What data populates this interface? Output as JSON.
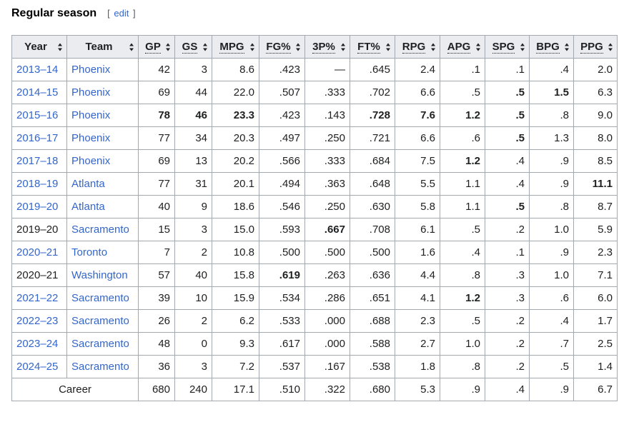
{
  "section": {
    "title": "Regular season",
    "edit_open": "[",
    "edit_label": "edit",
    "edit_close": "]"
  },
  "columns": [
    {
      "key": "year",
      "label": "Year",
      "abbr": false
    },
    {
      "key": "team",
      "label": "Team",
      "abbr": false
    },
    {
      "key": "gp",
      "label": "GP",
      "abbr": true
    },
    {
      "key": "gs",
      "label": "GS",
      "abbr": true
    },
    {
      "key": "mpg",
      "label": "MPG",
      "abbr": true
    },
    {
      "key": "fg",
      "label": "FG%",
      "abbr": true
    },
    {
      "key": "3p",
      "label": "3P%",
      "abbr": true
    },
    {
      "key": "ft",
      "label": "FT%",
      "abbr": true
    },
    {
      "key": "rpg",
      "label": "RPG",
      "abbr": true
    },
    {
      "key": "apg",
      "label": "APG",
      "abbr": true
    },
    {
      "key": "spg",
      "label": "SPG",
      "abbr": true
    },
    {
      "key": "bpg",
      "label": "BPG",
      "abbr": true
    },
    {
      "key": "ppg",
      "label": "PPG",
      "abbr": true
    }
  ],
  "rows": [
    {
      "year": "2013–14",
      "year_link": true,
      "team": "Phoenix",
      "team_link": true,
      "gp": "42",
      "gs": "3",
      "mpg": "8.6",
      "fg": ".423",
      "3p": "—",
      "ft": ".645",
      "rpg": "2.4",
      "apg": ".1",
      "spg": ".1",
      "bpg": ".4",
      "ppg": "2.0",
      "bold": []
    },
    {
      "year": "2014–15",
      "year_link": true,
      "team": "Phoenix",
      "team_link": true,
      "gp": "69",
      "gs": "44",
      "mpg": "22.0",
      "fg": ".507",
      "3p": ".333",
      "ft": ".702",
      "rpg": "6.6",
      "apg": ".5",
      "spg": ".5",
      "bpg": "1.5",
      "ppg": "6.3",
      "bold": [
        "spg",
        "bpg"
      ]
    },
    {
      "year": "2015–16",
      "year_link": true,
      "team": "Phoenix",
      "team_link": true,
      "gp": "78",
      "gs": "46",
      "mpg": "23.3",
      "fg": ".423",
      "3p": ".143",
      "ft": ".728",
      "rpg": "7.6",
      "apg": "1.2",
      "spg": ".5",
      "bpg": ".8",
      "ppg": "9.0",
      "bold": [
        "gp",
        "gs",
        "mpg",
        "ft",
        "rpg",
        "apg",
        "spg"
      ]
    },
    {
      "year": "2016–17",
      "year_link": true,
      "team": "Phoenix",
      "team_link": true,
      "gp": "77",
      "gs": "34",
      "mpg": "20.3",
      "fg": ".497",
      "3p": ".250",
      "ft": ".721",
      "rpg": "6.6",
      "apg": ".6",
      "spg": ".5",
      "bpg": "1.3",
      "ppg": "8.0",
      "bold": [
        "spg"
      ]
    },
    {
      "year": "2017–18",
      "year_link": true,
      "team": "Phoenix",
      "team_link": true,
      "gp": "69",
      "gs": "13",
      "mpg": "20.2",
      "fg": ".566",
      "3p": ".333",
      "ft": ".684",
      "rpg": "7.5",
      "apg": "1.2",
      "spg": ".4",
      "bpg": ".9",
      "ppg": "8.5",
      "bold": [
        "apg"
      ]
    },
    {
      "year": "2018–19",
      "year_link": true,
      "team": "Atlanta",
      "team_link": true,
      "gp": "77",
      "gs": "31",
      "mpg": "20.1",
      "fg": ".494",
      "3p": ".363",
      "ft": ".648",
      "rpg": "5.5",
      "apg": "1.1",
      "spg": ".4",
      "bpg": ".9",
      "ppg": "11.1",
      "bold": [
        "ppg"
      ]
    },
    {
      "year": "2019–20",
      "year_link": true,
      "team": "Atlanta",
      "team_link": true,
      "gp": "40",
      "gs": "9",
      "mpg": "18.6",
      "fg": ".546",
      "3p": ".250",
      "ft": ".630",
      "rpg": "5.8",
      "apg": "1.1",
      "spg": ".5",
      "bpg": ".8",
      "ppg": "8.7",
      "bold": [
        "spg"
      ]
    },
    {
      "year": "2019–20",
      "year_link": false,
      "team": "Sacramento",
      "team_link": true,
      "gp": "15",
      "gs": "3",
      "mpg": "15.0",
      "fg": ".593",
      "3p": ".667",
      "ft": ".708",
      "rpg": "6.1",
      "apg": ".5",
      "spg": ".2",
      "bpg": "1.0",
      "ppg": "5.9",
      "bold": [
        "3p"
      ]
    },
    {
      "year": "2020–21",
      "year_link": true,
      "team": "Toronto",
      "team_link": true,
      "gp": "7",
      "gs": "2",
      "mpg": "10.8",
      "fg": ".500",
      "3p": ".500",
      "ft": ".500",
      "rpg": "1.6",
      "apg": ".4",
      "spg": ".1",
      "bpg": ".9",
      "ppg": "2.3",
      "bold": []
    },
    {
      "year": "2020–21",
      "year_link": false,
      "team": "Washington",
      "team_link": true,
      "gp": "57",
      "gs": "40",
      "mpg": "15.8",
      "fg": ".619",
      "3p": ".263",
      "ft": ".636",
      "rpg": "4.4",
      "apg": ".8",
      "spg": ".3",
      "bpg": "1.0",
      "ppg": "7.1",
      "bold": [
        "fg"
      ]
    },
    {
      "year": "2021–22",
      "year_link": true,
      "team": "Sacramento",
      "team_link": true,
      "gp": "39",
      "gs": "10",
      "mpg": "15.9",
      "fg": ".534",
      "3p": ".286",
      "ft": ".651",
      "rpg": "4.1",
      "apg": "1.2",
      "spg": ".3",
      "bpg": ".6",
      "ppg": "6.0",
      "bold": [
        "apg"
      ]
    },
    {
      "year": "2022–23",
      "year_link": true,
      "team": "Sacramento",
      "team_link": true,
      "gp": "26",
      "gs": "2",
      "mpg": "6.2",
      "fg": ".533",
      "3p": ".000",
      "ft": ".688",
      "rpg": "2.3",
      "apg": ".5",
      "spg": ".2",
      "bpg": ".4",
      "ppg": "1.7",
      "bold": []
    },
    {
      "year": "2023–24",
      "year_link": true,
      "team": "Sacramento",
      "team_link": true,
      "gp": "48",
      "gs": "0",
      "mpg": "9.3",
      "fg": ".617",
      "3p": ".000",
      "ft": ".588",
      "rpg": "2.7",
      "apg": "1.0",
      "spg": ".2",
      "bpg": ".7",
      "ppg": "2.5",
      "bold": []
    },
    {
      "year": "2024–25",
      "year_link": true,
      "team": "Sacramento",
      "team_link": true,
      "gp": "36",
      "gs": "3",
      "mpg": "7.2",
      "fg": ".537",
      "3p": ".167",
      "ft": ".538",
      "rpg": "1.8",
      "apg": ".8",
      "spg": ".2",
      "bpg": ".5",
      "ppg": "1.4",
      "bold": []
    }
  ],
  "career": {
    "label": "Career",
    "gp": "680",
    "gs": "240",
    "mpg": "17.1",
    "fg": ".510",
    "3p": ".322",
    "ft": ".680",
    "rpg": "5.3",
    "apg": ".9",
    "spg": ".4",
    "bpg": ".9",
    "ppg": "6.7"
  },
  "colors": {
    "link": "#3366cc",
    "header_bg": "#eaecf0",
    "border": "#a2a9b1",
    "text": "#202122"
  }
}
